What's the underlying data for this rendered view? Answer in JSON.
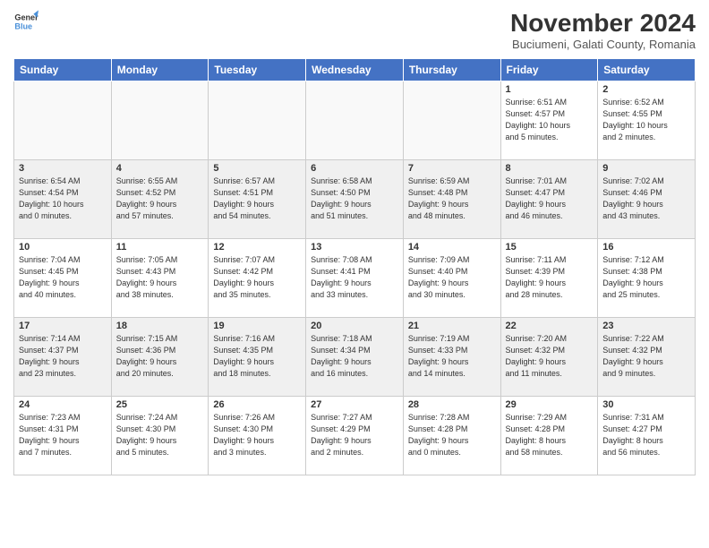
{
  "header": {
    "logo_line1": "General",
    "logo_line2": "Blue",
    "month": "November 2024",
    "location": "Buciumeni, Galati County, Romania"
  },
  "weekdays": [
    "Sunday",
    "Monday",
    "Tuesday",
    "Wednesday",
    "Thursday",
    "Friday",
    "Saturday"
  ],
  "weeks": [
    [
      {
        "day": "",
        "info": ""
      },
      {
        "day": "",
        "info": ""
      },
      {
        "day": "",
        "info": ""
      },
      {
        "day": "",
        "info": ""
      },
      {
        "day": "",
        "info": ""
      },
      {
        "day": "1",
        "info": "Sunrise: 6:51 AM\nSunset: 4:57 PM\nDaylight: 10 hours\nand 5 minutes."
      },
      {
        "day": "2",
        "info": "Sunrise: 6:52 AM\nSunset: 4:55 PM\nDaylight: 10 hours\nand 2 minutes."
      }
    ],
    [
      {
        "day": "3",
        "info": "Sunrise: 6:54 AM\nSunset: 4:54 PM\nDaylight: 10 hours\nand 0 minutes."
      },
      {
        "day": "4",
        "info": "Sunrise: 6:55 AM\nSunset: 4:52 PM\nDaylight: 9 hours\nand 57 minutes."
      },
      {
        "day": "5",
        "info": "Sunrise: 6:57 AM\nSunset: 4:51 PM\nDaylight: 9 hours\nand 54 minutes."
      },
      {
        "day": "6",
        "info": "Sunrise: 6:58 AM\nSunset: 4:50 PM\nDaylight: 9 hours\nand 51 minutes."
      },
      {
        "day": "7",
        "info": "Sunrise: 6:59 AM\nSunset: 4:48 PM\nDaylight: 9 hours\nand 48 minutes."
      },
      {
        "day": "8",
        "info": "Sunrise: 7:01 AM\nSunset: 4:47 PM\nDaylight: 9 hours\nand 46 minutes."
      },
      {
        "day": "9",
        "info": "Sunrise: 7:02 AM\nSunset: 4:46 PM\nDaylight: 9 hours\nand 43 minutes."
      }
    ],
    [
      {
        "day": "10",
        "info": "Sunrise: 7:04 AM\nSunset: 4:45 PM\nDaylight: 9 hours\nand 40 minutes."
      },
      {
        "day": "11",
        "info": "Sunrise: 7:05 AM\nSunset: 4:43 PM\nDaylight: 9 hours\nand 38 minutes."
      },
      {
        "day": "12",
        "info": "Sunrise: 7:07 AM\nSunset: 4:42 PM\nDaylight: 9 hours\nand 35 minutes."
      },
      {
        "day": "13",
        "info": "Sunrise: 7:08 AM\nSunset: 4:41 PM\nDaylight: 9 hours\nand 33 minutes."
      },
      {
        "day": "14",
        "info": "Sunrise: 7:09 AM\nSunset: 4:40 PM\nDaylight: 9 hours\nand 30 minutes."
      },
      {
        "day": "15",
        "info": "Sunrise: 7:11 AM\nSunset: 4:39 PM\nDaylight: 9 hours\nand 28 minutes."
      },
      {
        "day": "16",
        "info": "Sunrise: 7:12 AM\nSunset: 4:38 PM\nDaylight: 9 hours\nand 25 minutes."
      }
    ],
    [
      {
        "day": "17",
        "info": "Sunrise: 7:14 AM\nSunset: 4:37 PM\nDaylight: 9 hours\nand 23 minutes."
      },
      {
        "day": "18",
        "info": "Sunrise: 7:15 AM\nSunset: 4:36 PM\nDaylight: 9 hours\nand 20 minutes."
      },
      {
        "day": "19",
        "info": "Sunrise: 7:16 AM\nSunset: 4:35 PM\nDaylight: 9 hours\nand 18 minutes."
      },
      {
        "day": "20",
        "info": "Sunrise: 7:18 AM\nSunset: 4:34 PM\nDaylight: 9 hours\nand 16 minutes."
      },
      {
        "day": "21",
        "info": "Sunrise: 7:19 AM\nSunset: 4:33 PM\nDaylight: 9 hours\nand 14 minutes."
      },
      {
        "day": "22",
        "info": "Sunrise: 7:20 AM\nSunset: 4:32 PM\nDaylight: 9 hours\nand 11 minutes."
      },
      {
        "day": "23",
        "info": "Sunrise: 7:22 AM\nSunset: 4:32 PM\nDaylight: 9 hours\nand 9 minutes."
      }
    ],
    [
      {
        "day": "24",
        "info": "Sunrise: 7:23 AM\nSunset: 4:31 PM\nDaylight: 9 hours\nand 7 minutes."
      },
      {
        "day": "25",
        "info": "Sunrise: 7:24 AM\nSunset: 4:30 PM\nDaylight: 9 hours\nand 5 minutes."
      },
      {
        "day": "26",
        "info": "Sunrise: 7:26 AM\nSunset: 4:30 PM\nDaylight: 9 hours\nand 3 minutes."
      },
      {
        "day": "27",
        "info": "Sunrise: 7:27 AM\nSunset: 4:29 PM\nDaylight: 9 hours\nand 2 minutes."
      },
      {
        "day": "28",
        "info": "Sunrise: 7:28 AM\nSunset: 4:28 PM\nDaylight: 9 hours\nand 0 minutes."
      },
      {
        "day": "29",
        "info": "Sunrise: 7:29 AM\nSunset: 4:28 PM\nDaylight: 8 hours\nand 58 minutes."
      },
      {
        "day": "30",
        "info": "Sunrise: 7:31 AM\nSunset: 4:27 PM\nDaylight: 8 hours\nand 56 minutes."
      }
    ]
  ]
}
